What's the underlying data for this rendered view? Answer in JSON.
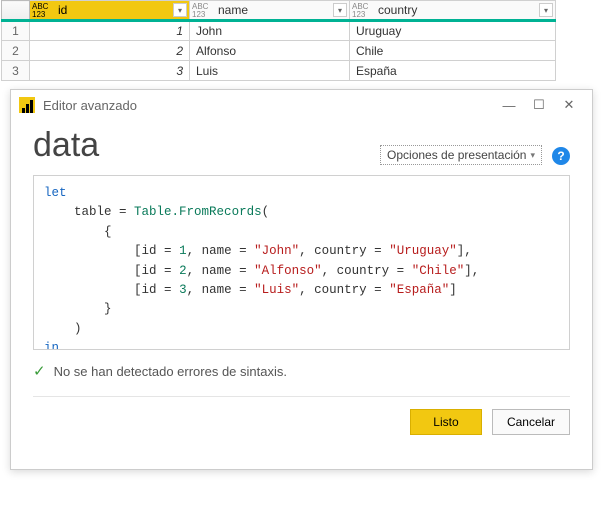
{
  "table": {
    "columns": [
      {
        "name": "id",
        "selected": true
      },
      {
        "name": "name",
        "selected": false
      },
      {
        "name": "country",
        "selected": false
      }
    ],
    "rows": [
      {
        "n": "1",
        "id": "1",
        "name": "John",
        "country": "Uruguay"
      },
      {
        "n": "2",
        "id": "2",
        "name": "Alfonso",
        "country": "Chile"
      },
      {
        "n": "3",
        "id": "3",
        "name": "Luis",
        "country": "España"
      }
    ],
    "type_label_top": "ABC",
    "type_label_bot": "123"
  },
  "dialog": {
    "title": "Editor avanzado",
    "query_name": "data",
    "display_options": "Opciones de presentación",
    "help": "?",
    "status": "No se han detectado errores de sintaxis.",
    "buttons": {
      "ok": "Listo",
      "cancel": "Cancelar"
    }
  },
  "code": {
    "let": "let",
    "in": "in",
    "tablevar": "table",
    "fn": "Table.FromRecords",
    "rows": [
      {
        "id": "1",
        "name": "\"John\"",
        "country": "\"Uruguay\"",
        "comma": ","
      },
      {
        "id": "2",
        "name": "\"Alfonso\"",
        "country": "\"Chile\"",
        "comma": ","
      },
      {
        "id": "3",
        "name": "\"Luis\"",
        "country": "\"España\"",
        "comma": ""
      }
    ]
  }
}
